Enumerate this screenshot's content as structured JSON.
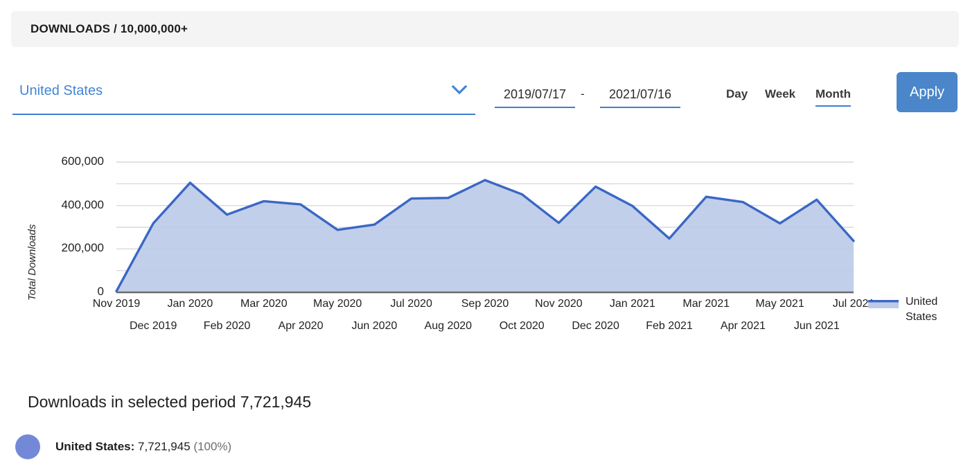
{
  "banner": {
    "title": "DOWNLOADS / 10,000,000+"
  },
  "controls": {
    "country": {
      "value": "United States",
      "chevron_icon": "chevron-down-icon"
    },
    "date_from": "2019/07/17",
    "date_separator": "-",
    "date_to": "2021/07/16",
    "granularity": {
      "day": "Day",
      "week": "Week",
      "month": "Month",
      "selected": "Month"
    },
    "apply_label": "Apply"
  },
  "footer": {
    "summary": "Downloads in selected period 7,721,945",
    "breakdown_label": "United States:",
    "breakdown_value": "7,721,945",
    "breakdown_percent": "(100%)"
  },
  "colors": {
    "accent": "#4285d6",
    "line": "#3a67c4",
    "area": "#bdcbe8",
    "button": "#4a86c9",
    "banner_bg": "#f4f4f4",
    "dot": "#7389d8",
    "grid": "#d9d9d9",
    "axis": "#6b6b6b"
  },
  "chart_data": {
    "type": "area",
    "title": "",
    "xlabel": "",
    "ylabel": "Total Downloads",
    "ylim": [
      0,
      600000
    ],
    "yticks": [
      0,
      200000,
      400000,
      600000
    ],
    "ytick_labels": [
      "0",
      "200,000",
      "400,000",
      "600,000"
    ],
    "gridlines": [
      100000,
      200000,
      300000,
      400000,
      500000,
      600000
    ],
    "grid": true,
    "legend_position": "right",
    "legend": [
      "United States"
    ],
    "categories": [
      "Nov 2019",
      "Dec 2019",
      "Jan 2020",
      "Feb 2020",
      "Mar 2020",
      "Apr 2020",
      "May 2020",
      "Jun 2020",
      "Jul 2020",
      "Aug 2020",
      "Sep 2020",
      "Oct 2020",
      "Nov 2020",
      "Dec 2020",
      "Jan 2021",
      "Feb 2021",
      "Mar 2021",
      "Apr 2021",
      "May 2021",
      "Jun 2021",
      "Jul 2021"
    ],
    "series": [
      {
        "name": "United States",
        "values": [
          5000,
          318000,
          505000,
          358000,
          420000,
          405000,
          288000,
          312000,
          432000,
          435000,
          517000,
          452000,
          320000,
          487000,
          398000,
          248000,
          440000,
          416000,
          318000,
          427000,
          237000
        ]
      }
    ]
  }
}
